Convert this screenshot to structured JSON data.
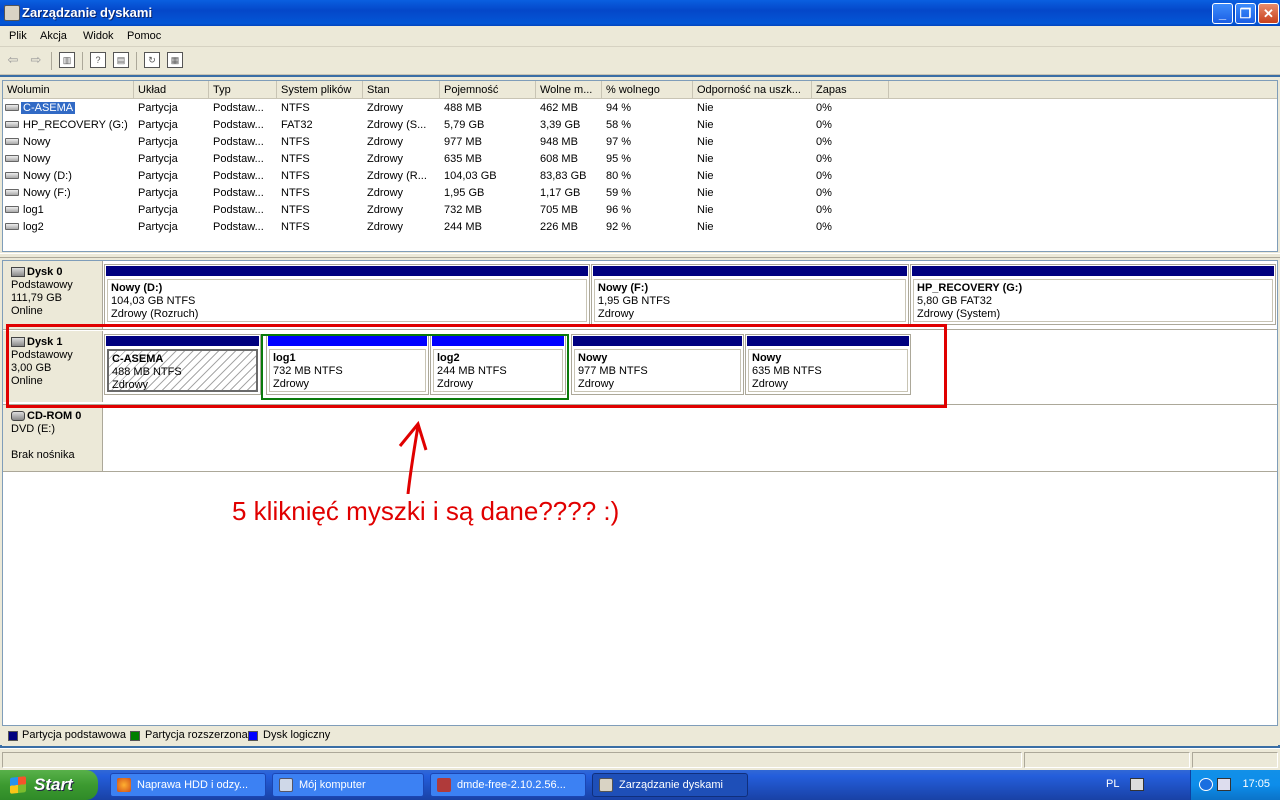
{
  "window": {
    "title": "Zarządzanie dyskami"
  },
  "menu": [
    "Plik",
    "Akcja",
    "Widok",
    "Pomoc"
  ],
  "volume_table": {
    "columns": [
      "Wolumin",
      "Układ",
      "Typ",
      "System plików",
      "Stan",
      "Pojemność",
      "Wolne m...",
      "% wolnego",
      "Odporność na uszk...",
      "Zapas"
    ],
    "rows": [
      [
        "C-ASEMA",
        "Partycja",
        "Podstaw...",
        "NTFS",
        "Zdrowy",
        "488 MB",
        "462 MB",
        "94 %",
        "Nie",
        "0%"
      ],
      [
        "HP_RECOVERY (G:)",
        "Partycja",
        "Podstaw...",
        "FAT32",
        "Zdrowy (S...",
        "5,79 GB",
        "3,39 GB",
        "58 %",
        "Nie",
        "0%"
      ],
      [
        "Nowy",
        "Partycja",
        "Podstaw...",
        "NTFS",
        "Zdrowy",
        "977 MB",
        "948 MB",
        "97 %",
        "Nie",
        "0%"
      ],
      [
        "Nowy",
        "Partycja",
        "Podstaw...",
        "NTFS",
        "Zdrowy",
        "635 MB",
        "608 MB",
        "95 %",
        "Nie",
        "0%"
      ],
      [
        "Nowy (D:)",
        "Partycja",
        "Podstaw...",
        "NTFS",
        "Zdrowy (R...",
        "104,03 GB",
        "83,83 GB",
        "80 %",
        "Nie",
        "0%"
      ],
      [
        "Nowy (F:)",
        "Partycja",
        "Podstaw...",
        "NTFS",
        "Zdrowy",
        "1,95 GB",
        "1,17 GB",
        "59 %",
        "Nie",
        "0%"
      ],
      [
        "log1",
        "Partycja",
        "Podstaw...",
        "NTFS",
        "Zdrowy",
        "732 MB",
        "705 MB",
        "96 %",
        "Nie",
        "0%"
      ],
      [
        "log2",
        "Partycja",
        "Podstaw...",
        "NTFS",
        "Zdrowy",
        "244 MB",
        "226 MB",
        "92 %",
        "Nie",
        "0%"
      ]
    ]
  },
  "disks": {
    "disk0": {
      "name": "Dysk 0",
      "type": "Podstawowy",
      "size": "111,79 GB",
      "status": "Online",
      "partitions": [
        {
          "name": "Nowy  (D:)",
          "size": "104,03 GB NTFS",
          "status": "Zdrowy (Rozruch)"
        },
        {
          "name": "Nowy  (F:)",
          "size": "1,95 GB NTFS",
          "status": "Zdrowy"
        },
        {
          "name": "HP_RECOVERY  (G:)",
          "size": "5,80 GB FAT32",
          "status": "Zdrowy (System)"
        }
      ]
    },
    "disk1": {
      "name": "Dysk 1",
      "type": "Podstawowy",
      "size": "3,00 GB",
      "status": "Online",
      "partitions": [
        {
          "name": "C-ASEMA",
          "size": "488 MB NTFS",
          "status": "Zdrowy"
        },
        {
          "name": "log1",
          "size": "732 MB NTFS",
          "status": "Zdrowy"
        },
        {
          "name": "log2",
          "size": "244 MB NTFS",
          "status": "Zdrowy"
        },
        {
          "name": "Nowy",
          "size": "977 MB NTFS",
          "status": "Zdrowy"
        },
        {
          "name": "Nowy",
          "size": "635 MB NTFS",
          "status": "Zdrowy"
        }
      ]
    },
    "cdrom": {
      "name": "CD-ROM 0",
      "drive": "DVD (E:)",
      "status": "Brak nośnika"
    }
  },
  "legend": [
    "Partycja podstawowa",
    "Partycja rozszerzona",
    "Dysk logiczny"
  ],
  "colors": {
    "primary_partition": "#00007f",
    "extended_partition": "#008000",
    "logical_drive": "#0000ff",
    "annotation_red": "#e00000",
    "annotation_green": "#0a7a0a"
  },
  "annotation": {
    "text": "5 kliknięć myszki i są dane???? :)"
  },
  "taskbar": {
    "start": "Start",
    "tasks": [
      "Naprawa HDD  i odzy...",
      "Mój komputer",
      "dmde-free-2.10.2.56...",
      "Zarządzanie dyskami"
    ],
    "lang": "PL",
    "clock": "17:05"
  }
}
